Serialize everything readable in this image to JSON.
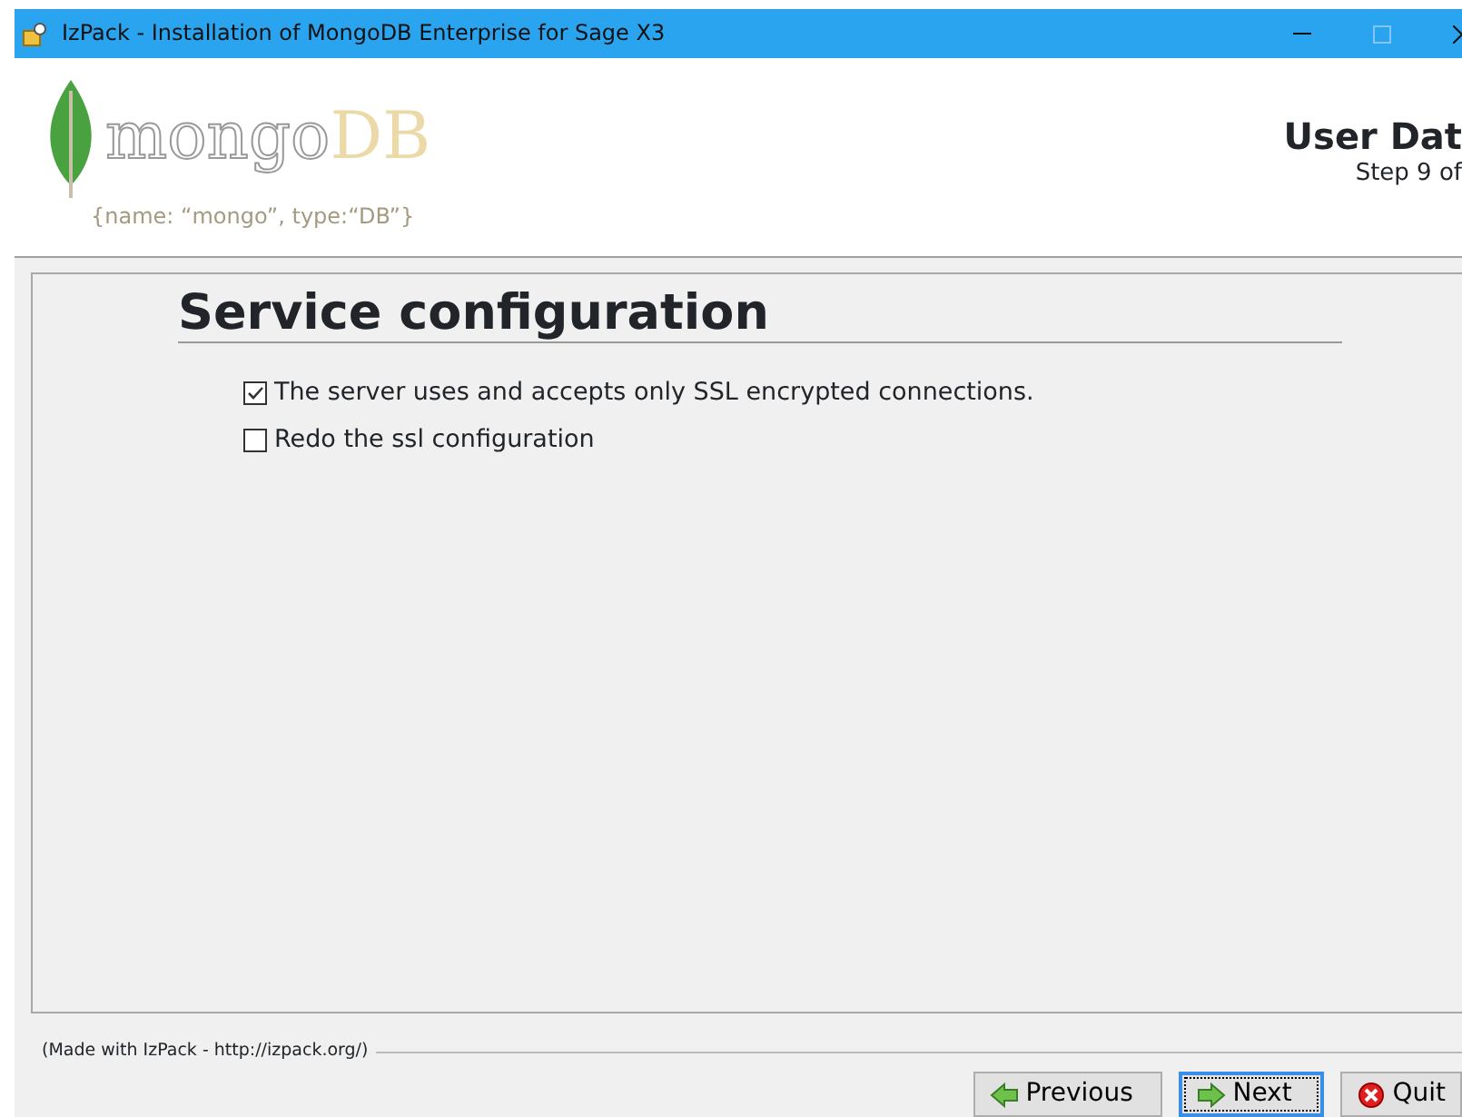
{
  "window": {
    "title": "IzPack - Installation of MongoDB Enterprise for Sage X3"
  },
  "header": {
    "logo_text": "mongo",
    "logo_text_accent": "DB",
    "tagline": "{name: “mongo”, type:“DB”}",
    "panel_title": "User Dat",
    "step": "Step 9 of"
  },
  "section": {
    "title": "Service configuration"
  },
  "options": [
    {
      "label": "The server uses and accepts only SSL encrypted connections.",
      "checked": true
    },
    {
      "label": "Redo the ssl configuration",
      "checked": false
    }
  ],
  "footer": {
    "credit": "(Made with IzPack - http://izpack.org/)"
  },
  "buttons": [
    {
      "label": "Previous",
      "kind": "previous",
      "focused": false
    },
    {
      "label": "Next",
      "kind": "next",
      "focused": true
    },
    {
      "label": "Quit",
      "kind": "quit",
      "focused": false
    }
  ]
}
